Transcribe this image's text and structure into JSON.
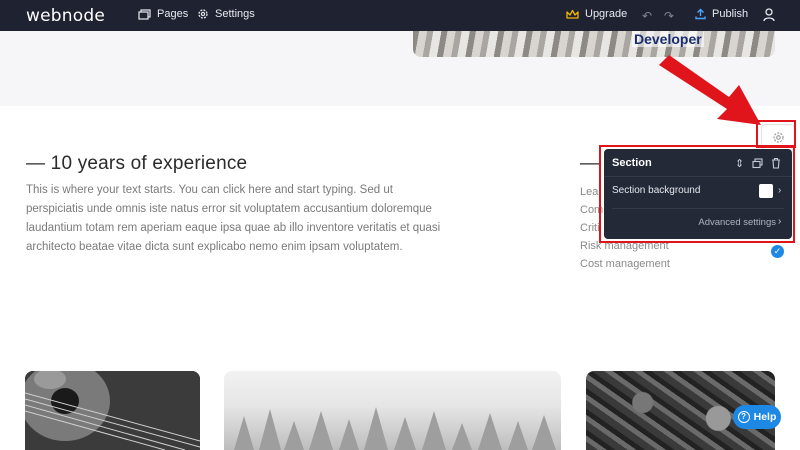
{
  "topbar": {
    "logo": "webnode",
    "pages_label": "Pages",
    "settings_label": "Settings",
    "upgrade_label": "Upgrade",
    "publish_label": "Publish"
  },
  "hero": {
    "image_caption": "Developer"
  },
  "content": {
    "heading": "— 10 years of experience",
    "paragraph": "This is where your text starts. You can click here and start typing. Sed ut perspiciatis unde omnis iste natus error sit voluptatem accusantium doloremque laudantium totam rem aperiam eaque ipsa quae ab illo inventore veritatis et quasi architecto beatae vitae dicta sunt explicabo nemo enim ipsam voluptatem.",
    "right_dash": "—",
    "list_items": [
      "Lea",
      "Com",
      "Criti",
      "Risk management",
      "Cost management"
    ]
  },
  "section_panel": {
    "title": "Section",
    "background_label": "Section background",
    "advanced_label": "Advanced settings"
  },
  "help": {
    "label": "Help"
  },
  "colors": {
    "topbar_bg": "#1f2331",
    "panel_bg": "#242938",
    "accent_blue": "#1e88e5",
    "annotation_red": "#e0151c",
    "upgrade_gold": "#f5b400"
  },
  "icons": [
    "pages-icon",
    "settings-gear-icon",
    "crown-icon",
    "undo-icon",
    "redo-icon",
    "upload-icon",
    "user-icon",
    "section-gear-icon",
    "reorder-icon",
    "duplicate-icon",
    "trash-icon",
    "chevron-right-icon",
    "check-icon",
    "help-icon"
  ]
}
